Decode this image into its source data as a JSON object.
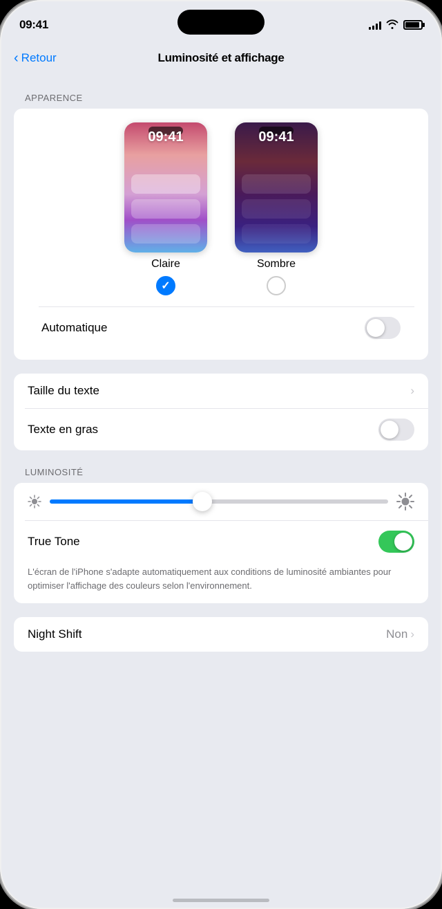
{
  "status": {
    "time": "09:41",
    "signal_bars": [
      4,
      6,
      8,
      11,
      14
    ],
    "wifi": "wifi",
    "battery": 90
  },
  "nav": {
    "back_label": "Retour",
    "title": "Luminosité et affichage"
  },
  "sections": {
    "appearance_label": "APPARENCE",
    "luminosity_label": "LUMINOSITÉ"
  },
  "appearance": {
    "light_label": "Claire",
    "dark_label": "Sombre",
    "light_time": "09:41",
    "dark_time": "09:41",
    "automatique_label": "Automatique",
    "automatique_on": false
  },
  "text_settings": {
    "text_size_label": "Taille du texte",
    "bold_text_label": "Texte en gras",
    "bold_on": false
  },
  "luminosity": {
    "brightness_pct": 45,
    "true_tone_label": "True Tone",
    "true_tone_on": true,
    "true_tone_desc": "L'écran de l'iPhone s'adapte automatiquement aux conditions de luminosité ambiantes pour optimiser l'affichage des couleurs selon l'environnement."
  },
  "night_shift": {
    "label": "Night Shift",
    "value": "Non"
  }
}
